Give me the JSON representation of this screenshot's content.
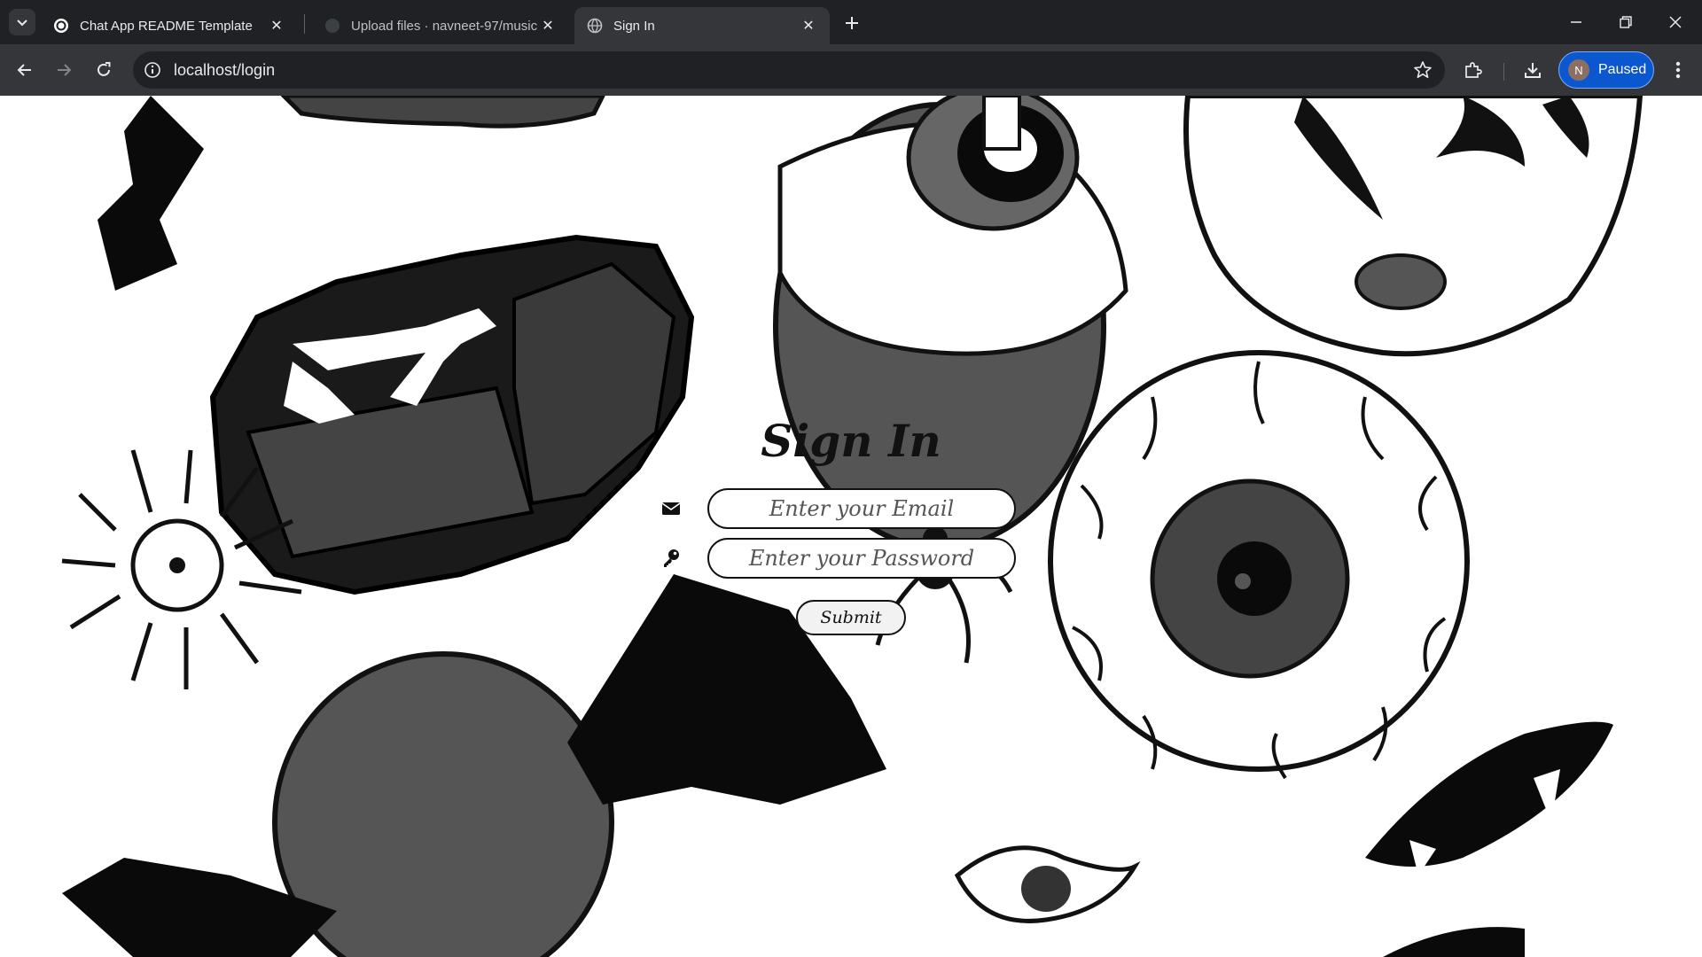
{
  "browser": {
    "tabs": [
      {
        "title": "Chat App README Template",
        "icon": "openai-icon",
        "active": false
      },
      {
        "title": "Upload files · navneet-97/music",
        "icon": "github-icon",
        "active": false
      },
      {
        "title": "Sign In",
        "icon": "globe-icon",
        "active": true
      }
    ],
    "address": "localhost/login",
    "profile_label": "Paused",
    "profile_initial": "N"
  },
  "page": {
    "heading": "Sign In",
    "email_placeholder": "Enter your Email",
    "password_placeholder": "Enter your Password",
    "submit_label": "Submit",
    "background": "black-and-white halloween doodle illustration"
  }
}
